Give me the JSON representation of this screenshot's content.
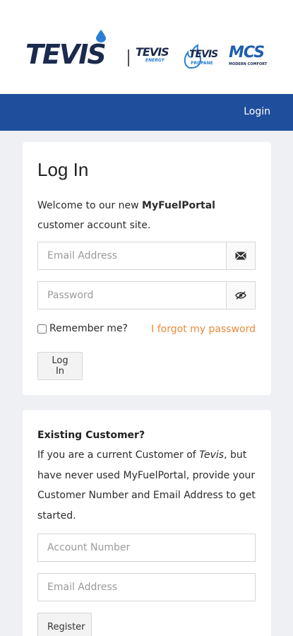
{
  "header": {
    "nav_login": "Login",
    "logos": {
      "main": "TEVIS",
      "energy": "TEVIS",
      "energy_sub": "ENERGY",
      "propane": "TEVIS",
      "propane_sub": "PROPANE",
      "mcs": "MCS",
      "mcs_sub": "MODERN COMFORT"
    }
  },
  "login": {
    "title": "Log In",
    "welcome_prefix": "Welcome to our new ",
    "welcome_brand": "MyFuelPortal",
    "welcome_suffix": " customer account site.",
    "email_placeholder": "Email Address",
    "password_placeholder": "Password",
    "remember_label": "Remember me?",
    "forgot_label": "I forgot my password",
    "login_button": "Log In"
  },
  "register": {
    "heading": "Existing Customer?",
    "text_prefix": "If you are a current Customer of ",
    "text_company": "Tevis",
    "text_suffix": ", but have never used MyFuelPortal, provide your Customer Number and Email Address to get started.",
    "account_placeholder": "Account Number",
    "email_placeholder": "Email Address",
    "register_button": "Register"
  },
  "colors": {
    "navbar": "#1f4f9c",
    "link_accent": "#e88b3a",
    "background": "#eef0f3"
  },
  "icons": {
    "email": "envelope-icon",
    "password": "eye-slash-icon",
    "logo_drop": "water-drop-icon"
  }
}
